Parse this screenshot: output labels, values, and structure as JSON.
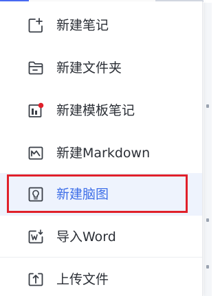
{
  "menu": {
    "items": [
      {
        "label": "新建笔记",
        "icon": "new-note-icon"
      },
      {
        "label": "新建文件夹",
        "icon": "folder-icon"
      },
      {
        "label": "新建模板笔记",
        "icon": "template-note-icon"
      },
      {
        "label": "新建Markdown",
        "icon": "markdown-icon"
      },
      {
        "label": "新建脑图",
        "icon": "mind-map-icon",
        "state": "hovered"
      },
      {
        "label": "导入Word",
        "icon": "import-word-icon"
      },
      {
        "label": "上传文件",
        "icon": "upload-file-icon"
      }
    ]
  },
  "colors": {
    "text": "#2b2f36",
    "icon": "#3a3f47",
    "hover_bg": "#eef3fd",
    "active_text": "#3d6ee8",
    "badge": "#e0202a",
    "highlight_border": "#e0202a",
    "accent": "#4a6cf7"
  }
}
